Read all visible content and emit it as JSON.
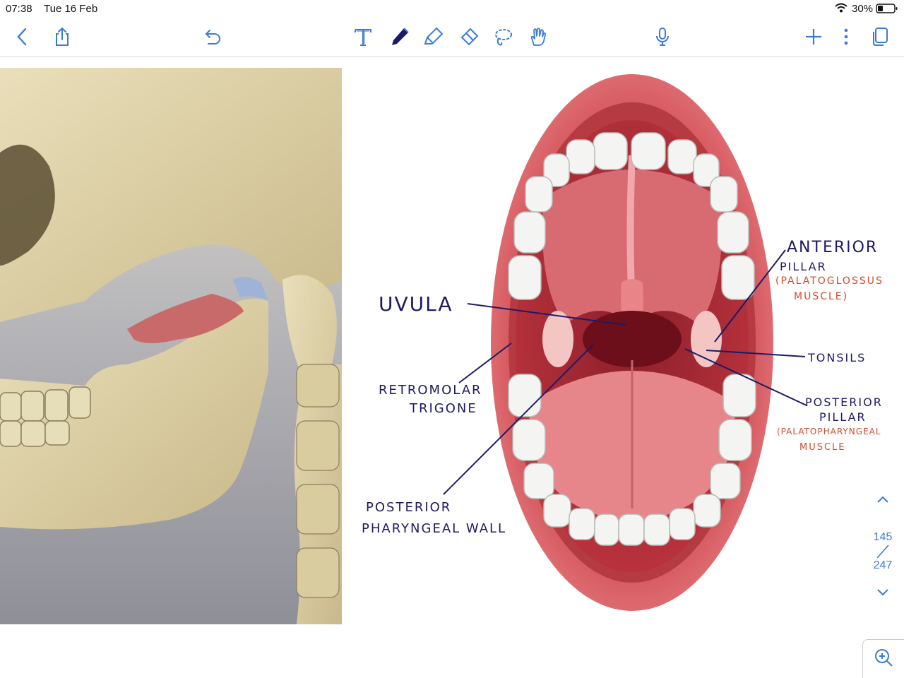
{
  "status": {
    "time": "07:38",
    "date": "Tue 16 Feb",
    "battery": "30%"
  },
  "toolbar": {
    "left_icons": [
      "back-icon",
      "share-icon",
      "undo-icon"
    ],
    "center_icons": [
      "text-tool-icon",
      "pen-icon",
      "highlighter-icon",
      "eraser-icon",
      "lasso-icon",
      "hand-gesture-icon",
      "microphone-icon"
    ],
    "right_icons": [
      "add-icon",
      "more-icon",
      "pages-icon"
    ],
    "active_tool": "pen"
  },
  "pager": {
    "current": "145",
    "separator": "/",
    "total": "247"
  },
  "annotations": {
    "uvula": "UVULA",
    "anterior_1": "ANTERIOR",
    "anterior_2": "PILLAR",
    "anterior_muscle_1": "(PALATOGLOSSUS",
    "anterior_muscle_2": "MUSCLE)",
    "tonsils": "TONSILS",
    "retromolar_1": "RETROMOLAR",
    "retromolar_2": "TRIGONE",
    "posterior_pillar_1": "POSTERIOR",
    "posterior_pillar_2": "PILLAR",
    "posterior_muscle_1": "(PALATOPHARYNGEAL",
    "posterior_muscle_2": "MUSCLE",
    "pharyngeal_1": "POSTERIOR",
    "pharyngeal_2": "PHARYNGEAL WALL"
  },
  "colors": {
    "accent": "#3b7bd6",
    "ink": "#1d1a66",
    "red_ink": "#d14a2c"
  }
}
